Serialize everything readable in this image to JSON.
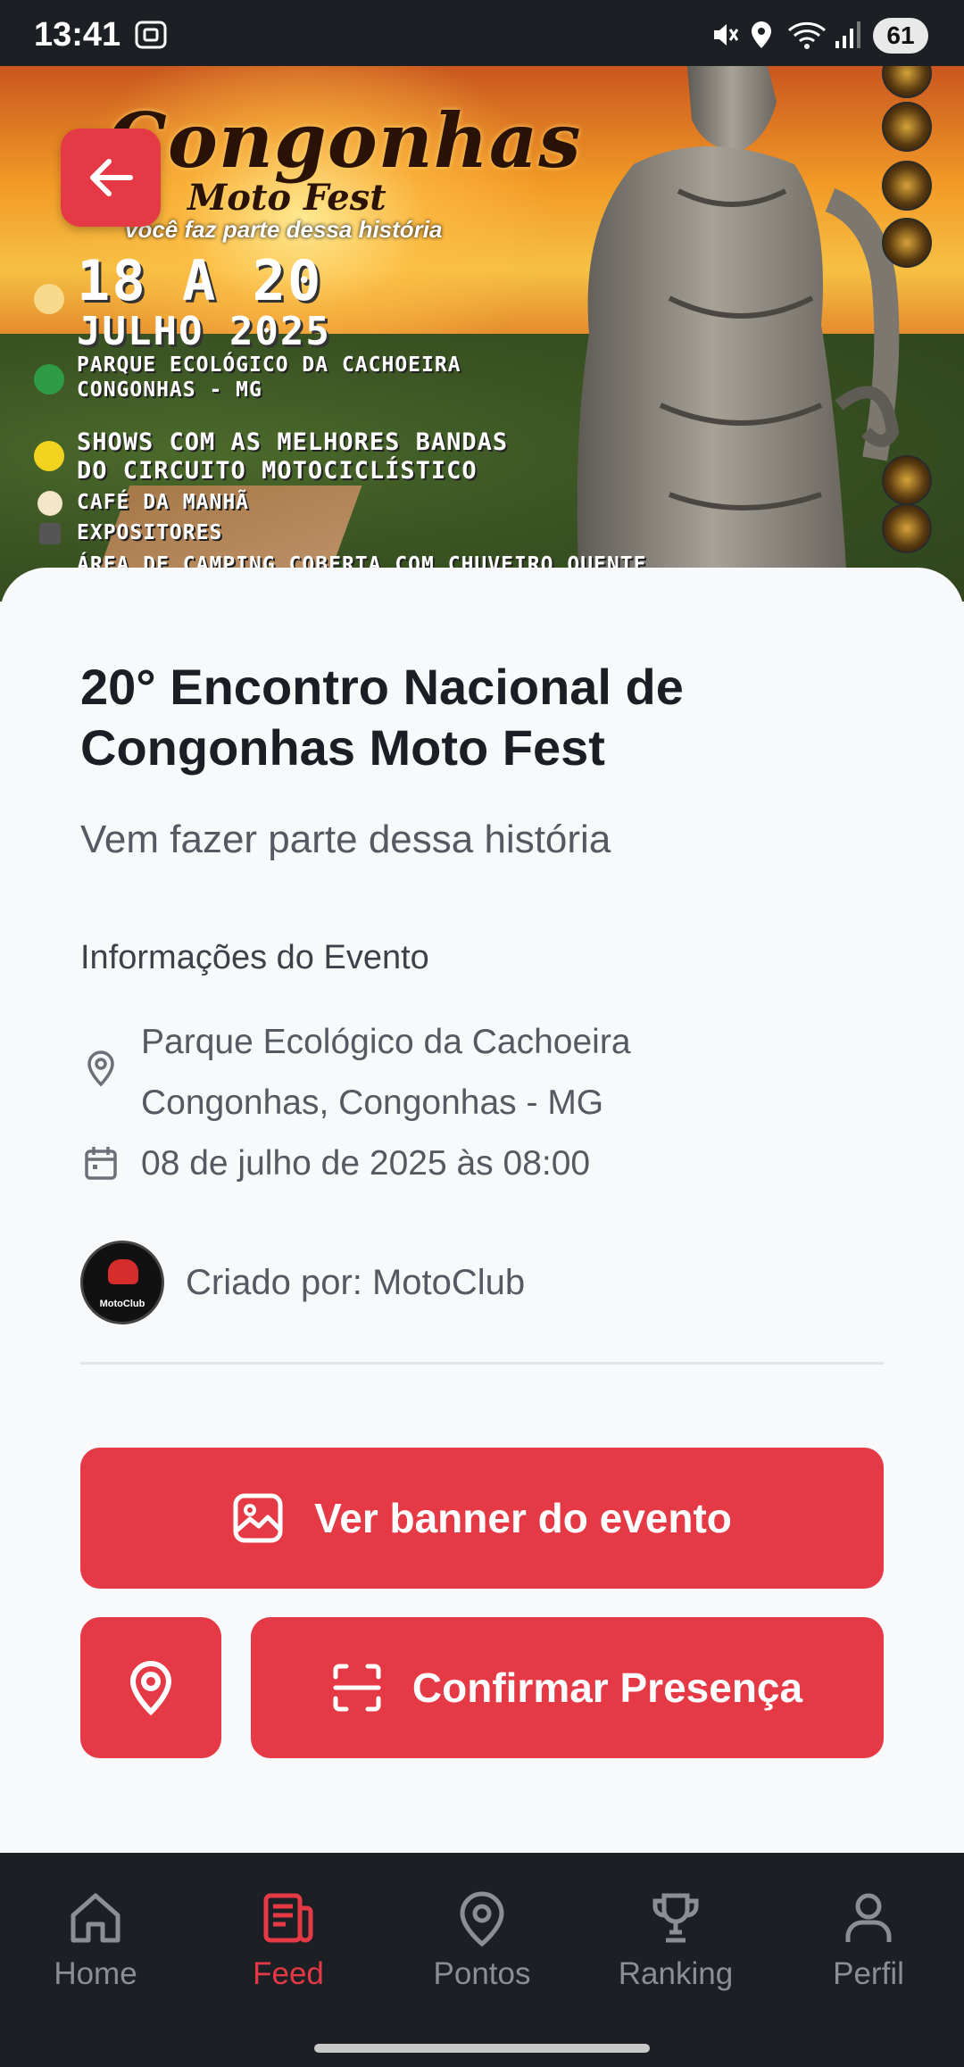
{
  "status_bar": {
    "time": "13:41",
    "battery": "61"
  },
  "banner": {
    "title": "Congonhas",
    "subtitle": "Moto Fest",
    "tagline": "você faz parte dessa história",
    "dates": "18 A 20",
    "month": "JULHO 2025",
    "location_line1": "PARQUE ECOLÓGICO DA CACHOEIRA",
    "location_line2": "CONGONHAS - MG",
    "shows_line1": "SHOWS COM AS MELHORES BANDAS",
    "shows_line2": "DO CIRCUITO MOTOCICLÍSTICO",
    "breakfast": "CAFÉ DA MANHÃ",
    "exhibitors": "EXPOSITORES",
    "camping": "ÁREA DE CAMPING COBERTA COM CHUVEIRO QUENTE"
  },
  "event": {
    "title": "20° Encontro Nacional de Congonhas Moto Fest",
    "subtitle": "Vem fazer parte dessa história",
    "info_heading": "Informações do Evento",
    "location_line1": "Parque Ecológico da Cachoeira",
    "location_line2": "Congonhas, Congonhas - MG",
    "datetime": "08 de julho de 2025 às 08:00",
    "creator_label": "Criado por: MotoClub",
    "creator_avatar_text": "MotoClub"
  },
  "actions": {
    "banner_button": "Ver banner do evento",
    "confirm_button": "Confirmar Presença"
  },
  "nav": {
    "items": [
      {
        "label": "Home",
        "icon": "home-icon"
      },
      {
        "label": "Feed",
        "icon": "feed-icon",
        "active": true
      },
      {
        "label": "Pontos",
        "icon": "location-pin-icon"
      },
      {
        "label": "Ranking",
        "icon": "trophy-icon"
      },
      {
        "label": "Perfil",
        "icon": "user-icon"
      }
    ]
  },
  "colors": {
    "accent": "#e53945",
    "dark_bar": "#1c1f23",
    "background": "#f8f9fb"
  }
}
